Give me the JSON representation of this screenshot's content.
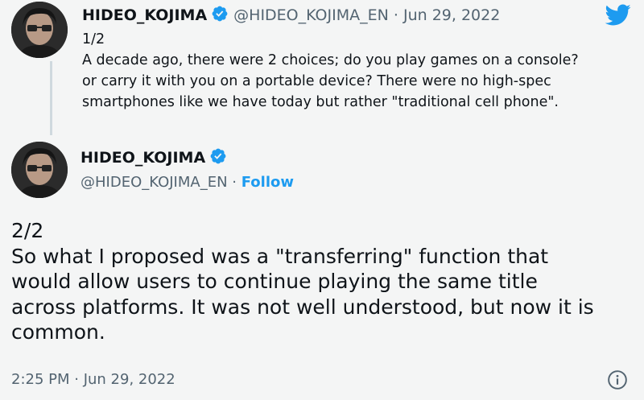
{
  "brand": {
    "logo_icon": "twitter-bird-icon",
    "color": "#1d9bf0"
  },
  "parent_tweet": {
    "display_name": "HIDEO_KOJIMA",
    "handle": "@HIDEO_KOJIMA_EN",
    "separator": "·",
    "date": "Jun 29, 2022",
    "text_lines": [
      "1/2",
      "A decade ago, there were 2 choices; do you play games on a console?",
      "or carry it with you on a portable device? There were no high-spec",
      "smartphones like we have today but rather \"traditional cell phone\"."
    ]
  },
  "main_tweet": {
    "display_name": "HIDEO_KOJIMA",
    "handle": "@HIDEO_KOJIMA_EN",
    "separator": "·",
    "follow_label": "Follow",
    "text_lines": [
      "2/2",
      "So what I proposed was a \"transferring\" function that",
      "would allow users to continue playing the same title",
      "across platforms. It was not well understood, but now it is",
      "common."
    ],
    "time": "2:25 PM",
    "date": "Jun 29, 2022"
  },
  "icons": {
    "verified": "verified-badge-icon",
    "info": "info-icon"
  },
  "colors": {
    "text": "#0f1419",
    "muted": "#536471",
    "link": "#1d9bf0",
    "background": "#f4f5f5"
  }
}
